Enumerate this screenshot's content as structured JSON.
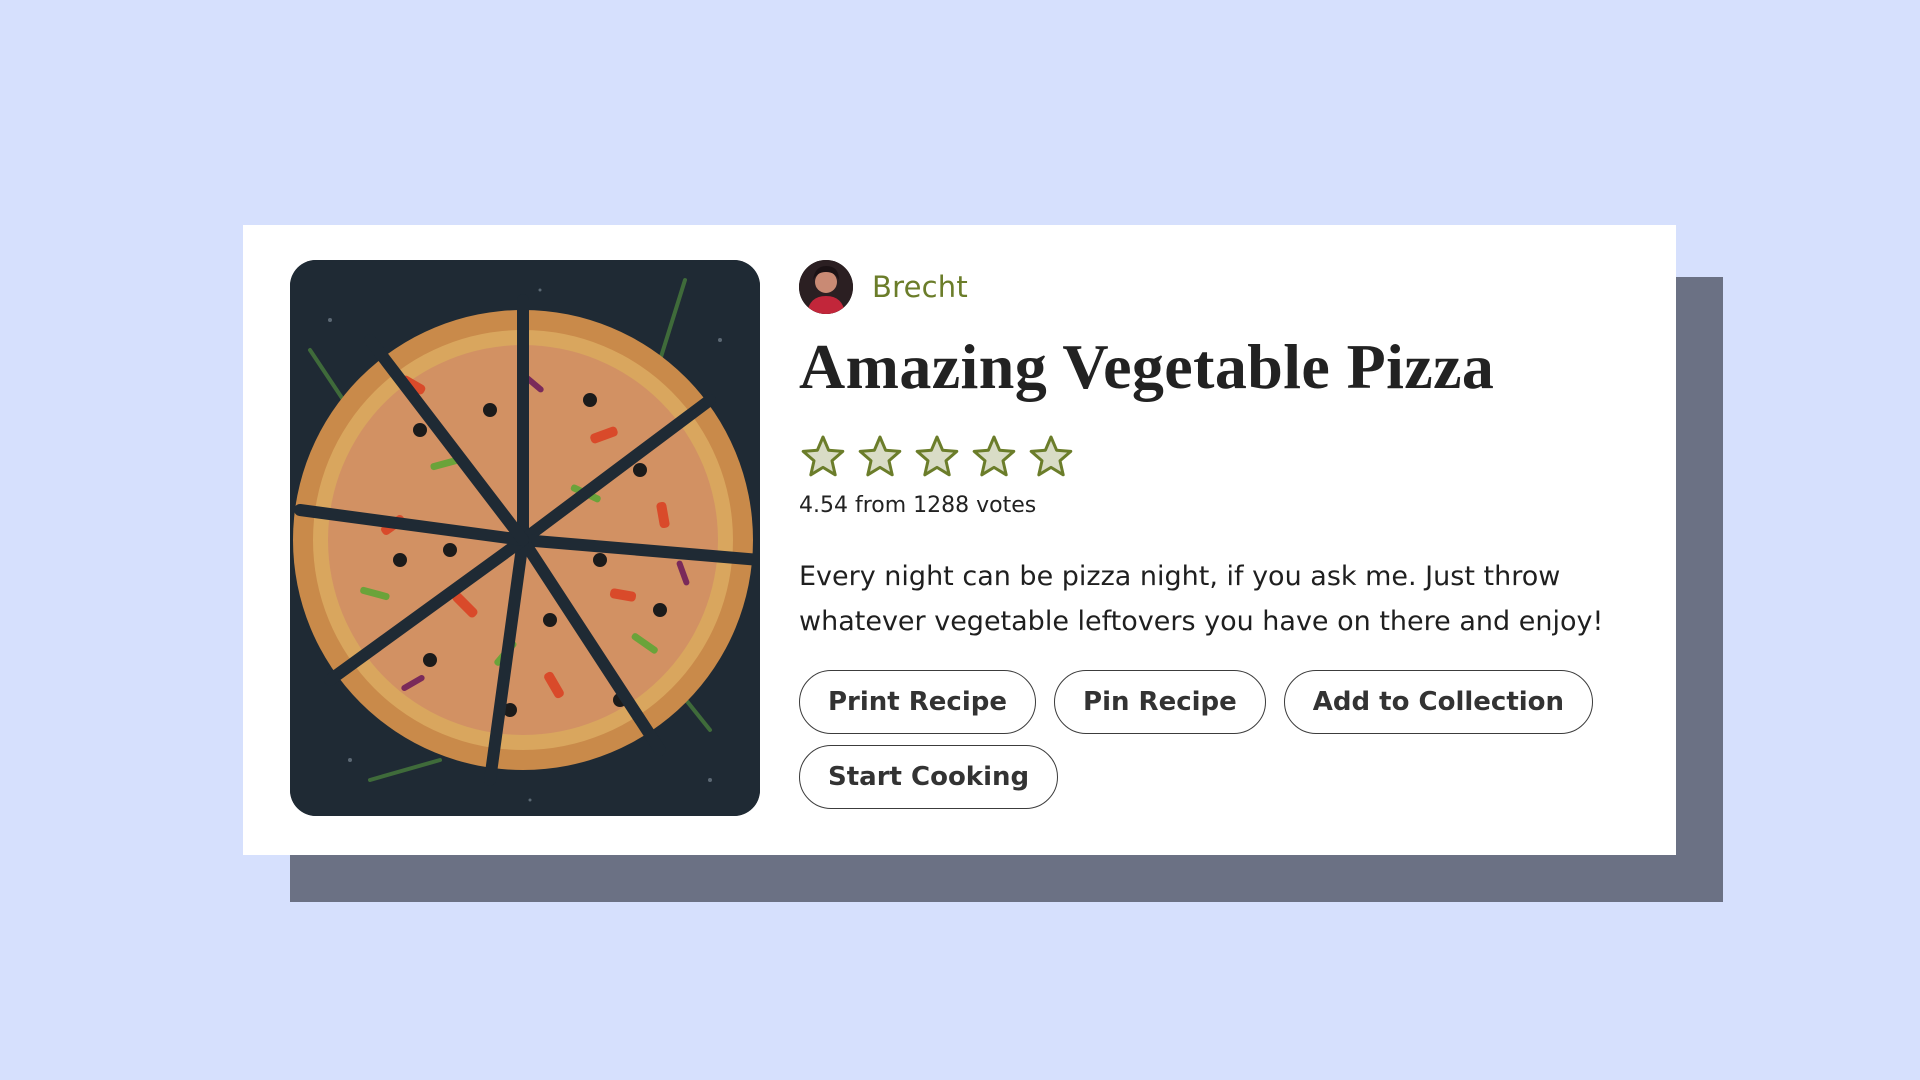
{
  "recipe": {
    "author": {
      "name": "Brecht",
      "avatar_icon": "author-avatar"
    },
    "title": "Amazing Vegetable Pizza",
    "image": {
      "subject": "pizza-photo"
    },
    "rating": {
      "average": 4.54,
      "max_stars": 5,
      "votes": 1288,
      "text": "4.54 from 1288 votes"
    },
    "description": "Every night can be pizza night, if you ask me. Just throw whatever vegetable leftovers you have on there and enjoy!",
    "actions": [
      {
        "label": "Print Recipe"
      },
      {
        "label": "Pin Recipe"
      },
      {
        "label": "Add to Collection"
      },
      {
        "label": "Start Cooking"
      }
    ]
  },
  "colors": {
    "background": "#d6e0fd",
    "card": "#ffffff",
    "card_shadow": "#6b7184",
    "accent": "#6b7d2a",
    "star_fill": "#d9dcc6",
    "star_stroke": "#6b7d2a",
    "title": "#222222"
  }
}
